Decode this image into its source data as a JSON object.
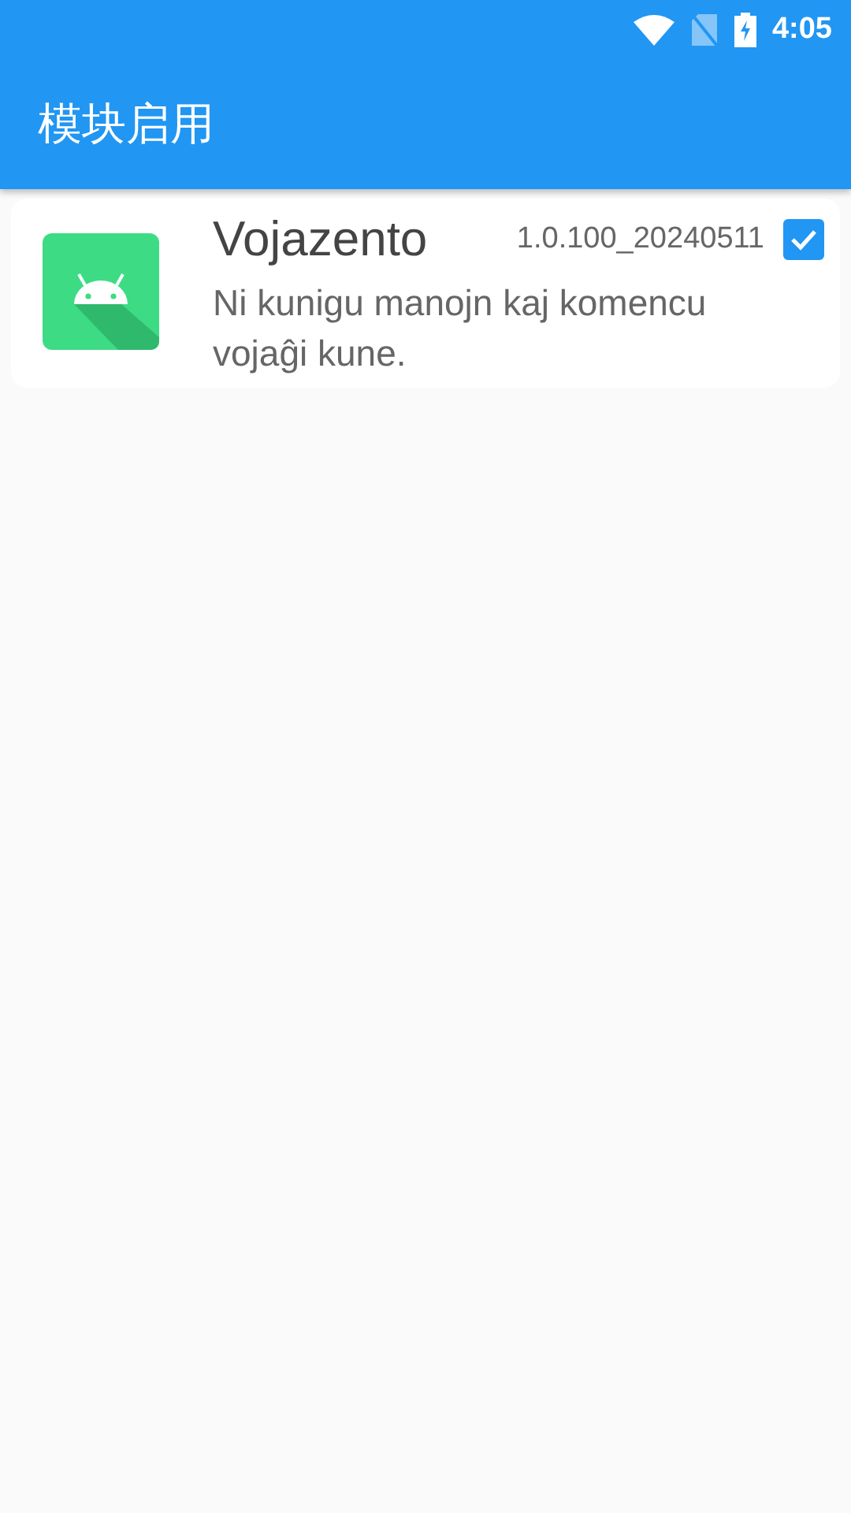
{
  "status_bar": {
    "time": "4:05"
  },
  "app_bar": {
    "title": "模块启用"
  },
  "modules": [
    {
      "name": "Vojazento",
      "version": "1.0.100_20240511",
      "description": "Ni kunigu manojn kaj komencu vojaĝi kune.",
      "checked": true
    }
  ]
}
